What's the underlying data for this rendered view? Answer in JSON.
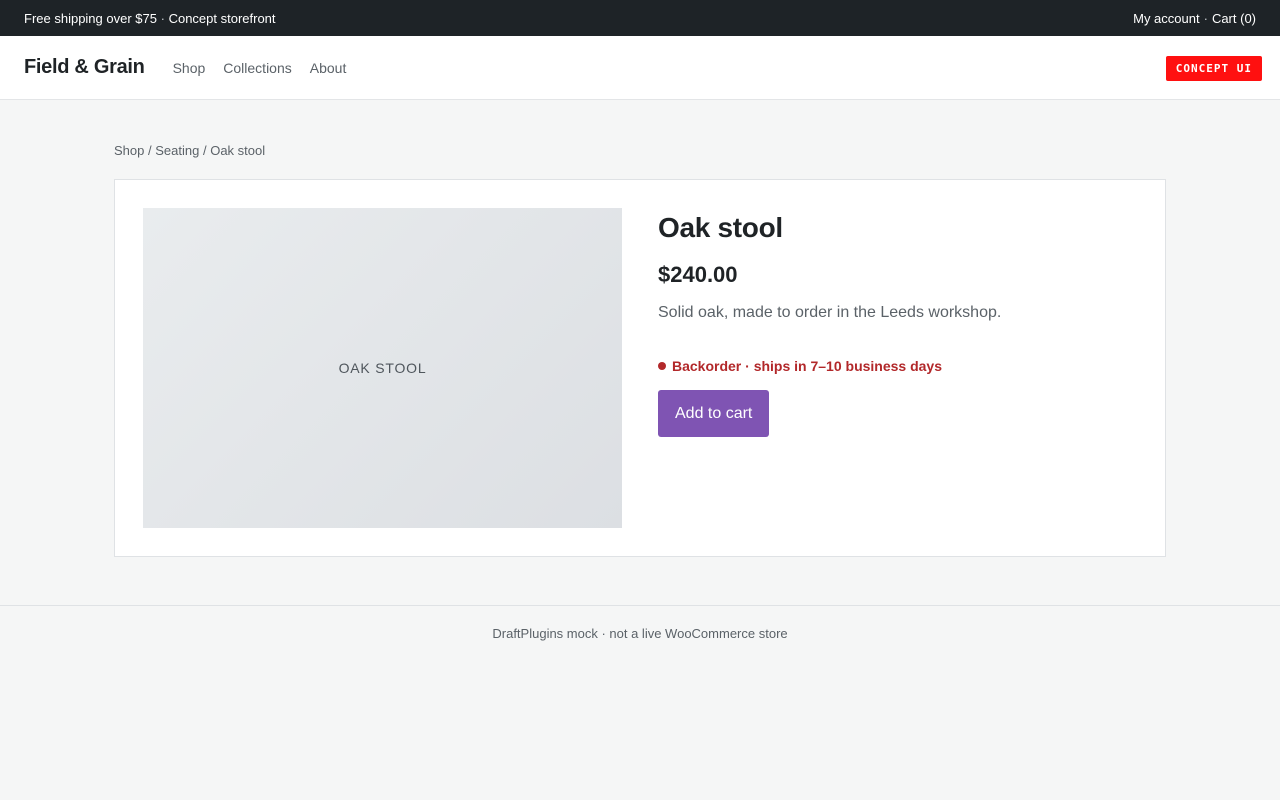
{
  "topbar": {
    "promo": "Free shipping over $75",
    "promo_sep": "·",
    "promo_sub": "Concept storefront",
    "account": "My account",
    "right_sep": "·",
    "cart": "Cart (0)"
  },
  "header": {
    "logo": "Field & Grain",
    "nav": [
      "Shop",
      "Collections",
      "About"
    ],
    "badge": "CONCEPT UI"
  },
  "breadcrumb": {
    "items": [
      "Shop",
      "Seating",
      "Oak stool"
    ],
    "sep": "/"
  },
  "product": {
    "image_label": "OAK STOOL",
    "title": "Oak stool",
    "price": "$240.00",
    "description": "Solid oak, made to order in the Leeds workshop.",
    "stock_status": "Backorder · ships in 7–10 business days",
    "stock_color": "#b2282a",
    "add_to_cart": "Add to cart",
    "button_color": "#7f54b3"
  },
  "footer": {
    "text": "DraftPlugins mock · not a live WooCommerce store"
  }
}
